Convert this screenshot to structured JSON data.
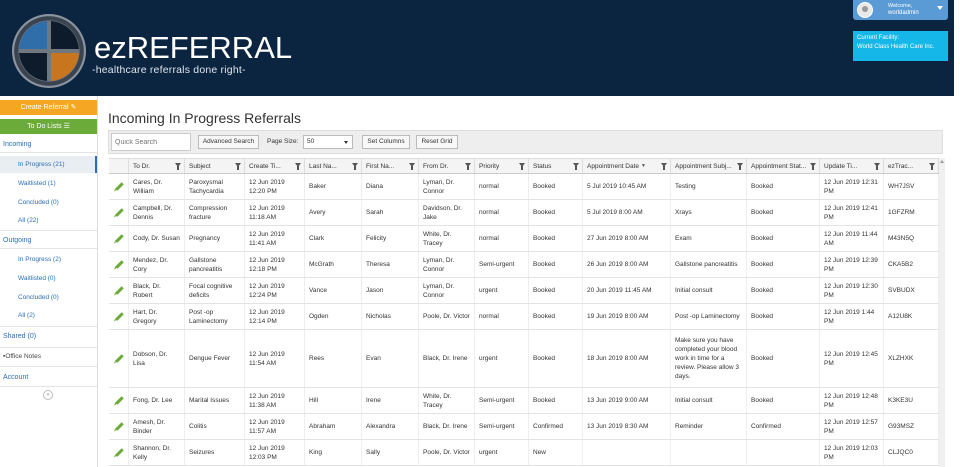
{
  "brand": {
    "name": "ezREFERRAL",
    "tagline": "-healthcare referrals done right-"
  },
  "user": {
    "welcome": "Welcome,",
    "name": "worldadmin"
  },
  "facility": {
    "label": "Current Facility:",
    "name": "World Class Health Care Inc."
  },
  "sidebar": {
    "create_referral": "Create Referral",
    "todo_lists": "To Do Lists",
    "incoming": "Incoming",
    "incoming_items": [
      "In Progress (21)",
      "Waitlisted (1)",
      "Concluded (0)",
      "All (22)"
    ],
    "outgoing": "Outgoing",
    "outgoing_items": [
      "In Progress (2)",
      "Waitlisted (0)",
      "Concluded (0)",
      "All (2)"
    ],
    "shared": "Shared (0)",
    "office_notes": "Office Notes",
    "account": "Account"
  },
  "page": {
    "title": "Incoming In Progress Referrals"
  },
  "toolbar": {
    "search_placeholder": "Quick Search",
    "advanced_search": "Advanced Search",
    "page_size_label": "Page Size:",
    "page_size_value": "50",
    "set_columns": "Set Columns",
    "reset_grid": "Reset Grid"
  },
  "grid": {
    "headers": [
      "To Dr.",
      "Subject",
      "Create Ti...",
      "Last Na...",
      "First Na...",
      "From Dr.",
      "Priority",
      "Status",
      "Appointment Date",
      "Appointment Subj...",
      "Appointment Stat...",
      "Update Ti...",
      "ezTrac..."
    ],
    "rows": [
      [
        "Cares, Dr. William",
        "Paroxysmal Tachycardia",
        "12 Jun 2019 12:20 PM",
        "Baker",
        "Diana",
        "Lyman, Dr. Connor",
        "normal",
        "Booked",
        "5 Jul 2019 10:45 AM",
        "Testing",
        "Booked",
        "12 Jun 2019 12:31 PM",
        "WH7JSV"
      ],
      [
        "Campbell, Dr. Dennis",
        "Compression fracture",
        "12 Jun 2019 11:18 AM",
        "Avery",
        "Sarah",
        "Davidson, Dr. Jake",
        "normal",
        "Booked",
        "5 Jul 2019 8:00 AM",
        "Xrays",
        "Booked",
        "12 Jun 2019 12:41 PM",
        "1GFZRM"
      ],
      [
        "Cody, Dr. Susan",
        "Pregnancy",
        "12 Jun 2019 11:41 AM",
        "Clark",
        "Felicity",
        "White, Dr. Tracey",
        "normal",
        "Booked",
        "27 Jun 2019 8:00 AM",
        "Exam",
        "Booked",
        "12 Jun 2019 11:44 AM",
        "M43N5Q"
      ],
      [
        "Mendez, Dr. Cory",
        "Gallstone pancreatitis",
        "12 Jun 2019 12:18 PM",
        "McGrath",
        "Theresa",
        "Lyman, Dr. Connor",
        "Semi-urgent",
        "Booked",
        "26 Jun 2019 8:00 AM",
        "Gallstone pancreatitis",
        "Booked",
        "12 Jun 2019 12:39 PM",
        "CKA5B2"
      ],
      [
        "Black, Dr. Robert",
        "Focal cognitive deficits",
        "12 Jun 2019 12:24 PM",
        "Vance",
        "Jason",
        "Lyman, Dr. Connor",
        "urgent",
        "Booked",
        "20 Jun 2019 11:45 AM",
        "Initial consult",
        "Booked",
        "12 Jun 2019 12:30 PM",
        "SVBUDX"
      ],
      [
        "Hart, Dr. Gregory",
        "Post -op Laminectomy",
        "12 Jun 2019 12:14 PM",
        "Ogden",
        "Nicholas",
        "Poole, Dr. Victor",
        "normal",
        "Booked",
        "19 Jun 2019 8:00 AM",
        "Post -op Laminectomy",
        "Booked",
        "12 Jun 2019 1:44 PM",
        "A12U8K"
      ],
      [
        "Dobson, Dr. Lisa",
        "Dengue Fever",
        "12 Jun 2019 11:54 AM",
        "Rees",
        "Evan",
        "Black, Dr. Irene",
        "urgent",
        "Booked",
        "18 Jun 2019 8:00 AM",
        "Make sure you have completed your blood work in time for a review. Please allow 3 days.",
        "Booked",
        "12 Jun 2019 12:45 PM",
        "XLZHXK"
      ],
      [
        "Fong, Dr. Lee",
        "Marital Issues",
        "12 Jun 2019 11:38 AM",
        "Hill",
        "Irene",
        "White, Dr. Tracey",
        "Semi-urgent",
        "Booked",
        "13 Jun 2019 9:00 AM",
        "Initial consult",
        "Booked",
        "12 Jun 2019 12:48 PM",
        "K3KE3U"
      ],
      [
        "Amesh, Dr. Binder",
        "Colitis",
        "12 Jun 2019 11:57 AM",
        "Abraham",
        "Alexandra",
        "Black, Dr. Irene",
        "Semi-urgent",
        "Confirmed",
        "13 Jun 2019 8:30 AM",
        "Reminder",
        "Confirmed",
        "12 Jun 2019 12:57 PM",
        "G93MSZ"
      ],
      [
        "Shannon, Dr. Kelly",
        "Seizures",
        "12 Jun 2019 12:03 PM",
        "King",
        "Sally",
        "Poole, Dr. Victor",
        "urgent",
        "New",
        "",
        "",
        "",
        "12 Jun 2019 12:03 PM",
        "CLJQC0"
      ]
    ]
  },
  "colors": {
    "header_bg": "#0b2440",
    "create_referral": "#f5a623",
    "todo": "#6aab3a",
    "facility": "#15b7e8",
    "user_box": "#5b9bd5",
    "link": "#2a6fb5"
  },
  "icons": {
    "edit": "pencil-icon",
    "filter": "filter-icon",
    "sort": "sort-down-icon",
    "collapse": "chevron-left-icon"
  }
}
